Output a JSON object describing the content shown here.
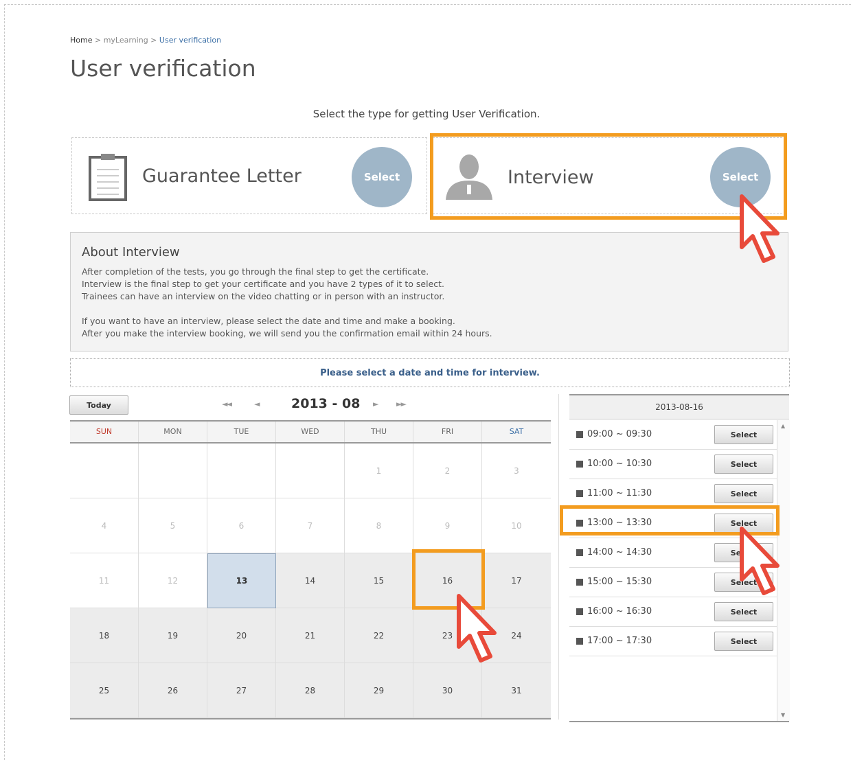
{
  "breadcrumb": {
    "home": "Home",
    "sep1": " > ",
    "mylearning": "myLearning",
    "sep2": " > ",
    "current": "User verification"
  },
  "page_title": "User verification",
  "instruction": "Select the type for getting User Verification.",
  "types": {
    "guarantee": {
      "label": "Guarantee Letter",
      "button": "Select",
      "icon": "clipboard-icon"
    },
    "interview": {
      "label": "Interview",
      "button": "Select",
      "icon": "person-icon"
    }
  },
  "about": {
    "title": "About Interview",
    "para1": [
      "After completion of the tests, you go through the final step to get the certificate.",
      "Interview is the final step to get your certificate and you have 2 types of it to select.",
      "Trainees can have an interview on the video chatting or in person with an instructor."
    ],
    "para2": [
      "If you want to have an interview, please select the date and time and make a booking.",
      "After you make the interview booking, we will send you the confirmation email within 24 hours."
    ]
  },
  "prompt": "Please select a date and time for interview.",
  "calendar": {
    "today_button": "Today",
    "month": "2013 - 08",
    "nav": {
      "first": "◄◄",
      "prev": "◄",
      "next": "►",
      "last": "►►"
    },
    "weekdays": [
      "SUN",
      "MON",
      "TUE",
      "WED",
      "THU",
      "FRI",
      "SAT"
    ],
    "weeks": [
      [
        "",
        "",
        "",
        "",
        "1",
        "2",
        "3"
      ],
      [
        "4",
        "5",
        "6",
        "7",
        "8",
        "9",
        "10"
      ],
      [
        "11",
        "12",
        "13",
        "14",
        "15",
        "16",
        "17"
      ],
      [
        "18",
        "19",
        "20",
        "21",
        "22",
        "23",
        "24"
      ],
      [
        "25",
        "26",
        "27",
        "28",
        "29",
        "30",
        "31"
      ]
    ],
    "today": "13",
    "selected": "16"
  },
  "timeslots": {
    "date": "2013-08-16",
    "button": "Select",
    "slots": [
      "09:00 ~ 09:30",
      "10:00 ~ 10:30",
      "11:00 ~ 11:30",
      "13:00 ~ 13:30",
      "14:00 ~ 14:30",
      "15:00 ~ 15:30",
      "16:00 ~ 16:30",
      "17:00 ~ 17:30"
    ],
    "selected": "13:00 ~ 13:30"
  },
  "colors": {
    "highlight": "#f39c1f",
    "select_circle": "#9fb6c8",
    "cursor_fill": "#e84a3a"
  }
}
